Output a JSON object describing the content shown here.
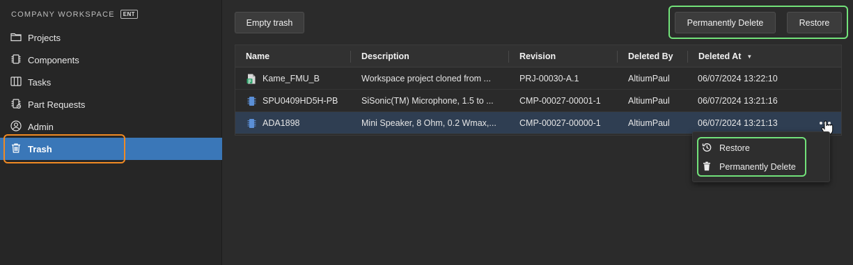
{
  "workspace": {
    "name": "COMPANY WORKSPACE",
    "badge": "ENT"
  },
  "nav": [
    {
      "label": "Projects",
      "icon": "folder-icon"
    },
    {
      "label": "Components",
      "icon": "chip-icon"
    },
    {
      "label": "Tasks",
      "icon": "board-icon"
    },
    {
      "label": "Part Requests",
      "icon": "part-request-icon"
    },
    {
      "label": "Admin",
      "icon": "user-circle-icon"
    },
    {
      "label": "Trash",
      "icon": "trash-icon",
      "active": true
    }
  ],
  "toolbar": {
    "empty_trash": "Empty trash",
    "permanently_delete": "Permanently Delete",
    "restore": "Restore"
  },
  "table": {
    "columns": [
      "Name",
      "Description",
      "Revision",
      "Deleted By",
      "Deleted At"
    ],
    "sorted_column": "Deleted At",
    "sort_direction": "descending",
    "rows": [
      {
        "name": "Kame_FMU_B",
        "icon": "project-icon",
        "description": "Workspace project cloned from ...",
        "revision": "PRJ-00030-A.1",
        "deleted_by": "AltiumPaul",
        "deleted_at": "06/07/2024 13:22:10"
      },
      {
        "name": "SPU0409HD5H-PB",
        "icon": "component-chip-icon",
        "description": "SiSonic(TM) Microphone, 1.5 to ...",
        "revision": "CMP-00027-00001-1",
        "deleted_by": "AltiumPaul",
        "deleted_at": "06/07/2024 13:21:16"
      },
      {
        "name": "ADA1898",
        "icon": "component-chip-icon",
        "description": "Mini Speaker, 8 Ohm, 0.2 Wmax,...",
        "revision": "CMP-00027-00000-1",
        "deleted_by": "AltiumPaul",
        "deleted_at": "06/07/2024 13:21:13",
        "selected": true
      }
    ]
  },
  "context_menu": {
    "items": [
      {
        "label": "Restore",
        "icon": "history-icon"
      },
      {
        "label": "Permanently Delete",
        "icon": "trash-icon"
      }
    ]
  },
  "colors": {
    "accent_active": "#3a77b8",
    "highlight_orange": "#f08a24",
    "highlight_green": "#72e27a",
    "selected_row": "#2f3e52"
  }
}
